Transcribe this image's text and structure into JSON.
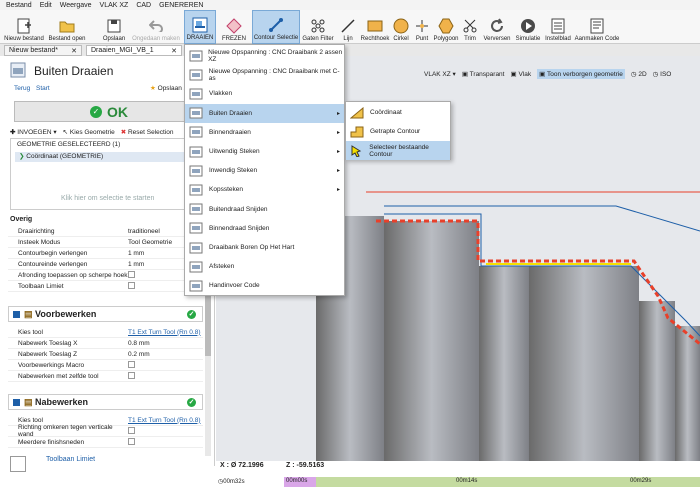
{
  "menubar": [
    "Bestand",
    "Edit",
    "Weergave",
    "VLAK XZ",
    "CAD",
    "GENEREREN"
  ],
  "ribbon": {
    "new_project": "Nieuw bestand",
    "open": "Bestand open",
    "save": "Opslaan",
    "undo": "Ongedaan maken",
    "turning": "DRAAIEN",
    "milling": "FREZEN",
    "contour_select": "Contour Selectie",
    "hole_filter": "Gaten Filter",
    "line": "Lijn",
    "rectangle": "Rechthoek",
    "circle": "Cirkel",
    "point": "Punt",
    "polygon": "Polygoon",
    "trim": "Trim",
    "refresh": "Verversen",
    "simulation": "Simulatie",
    "setup_sheet": "Instelblad",
    "make_code": "Aanmaken Code"
  },
  "tabs": [
    "Nieuw bestand*",
    "Draaien_MGI_VB_1"
  ],
  "panel": {
    "title": "Buiten Draaien",
    "back": "Terug",
    "start": "Start",
    "save_as": "Opslaan a",
    "ok": "OK",
    "insert": "INVOEGEN",
    "pick_geometry": "Kies Geometrie",
    "reset_selection": "Reset Selection",
    "selected_geometry": "GEOMETRIE GESELECTEERD",
    "selected_count": "(1)",
    "coordinate_item": "Coördinaat (GEOMETRIE)",
    "click_hint": "Klik hier om selectie te starten",
    "overig": "Overig",
    "props": [
      {
        "k": "Draairichting",
        "v": "traditioneel"
      },
      {
        "k": "Insteek Modus",
        "v": "Tool Geometrie"
      },
      {
        "k": "Contourbegin verlengen",
        "v": "1 mm"
      },
      {
        "k": "Contoureinde verlengen",
        "v": "1 mm"
      },
      {
        "k": "Afronding toepassen op scherpe hoek",
        "v": ""
      },
      {
        "k": "Toolbaan Limiet",
        "v": ""
      }
    ],
    "roughing": "Voorbewerken",
    "rough_props": [
      {
        "k": "Kies tool",
        "v": "T1 Ext Turn Tool  (Rn 0.8)"
      },
      {
        "k": "Nabewerk Toeslag X",
        "v": "0.8 mm"
      },
      {
        "k": "Nabewerk Toeslag Z",
        "v": "0.2 mm"
      },
      {
        "k": "Voorbewerkings Macro",
        "v": ""
      },
      {
        "k": "Nabewerken met zelfde tool",
        "v": ""
      }
    ],
    "finishing": "Nabewerken",
    "finish_props": [
      {
        "k": "Kies tool",
        "v": "T1 Ext Turn Tool  (Rn 0.8)"
      },
      {
        "k": "Richting omkeren tegen verticale wand",
        "v": ""
      },
      {
        "k": "Meerdere finishsneden",
        "v": ""
      }
    ],
    "toolpath_limit": "Toolbaan Limiet"
  },
  "viewtool": {
    "plane": "VLAK XZ",
    "transparent": "Transparant",
    "flat": "Vlak",
    "hidden_geometry": "Toon verborgen geometrie",
    "view2d": "2D",
    "iso": "ISO"
  },
  "draaien_menu": [
    "Nieuwe Opspanning : CNC Draaibank 2 assen XZ",
    "Nieuwe Opspanning : CNC Draaibank met C-as",
    "Vlakken",
    "Buiten Draaien",
    "Binnendraaien",
    "Uitwendig Steken",
    "Inwendig Steken",
    "Kopssteken",
    "Buitendraad Snijden",
    "Binnendraad Snijden",
    "Draaibank Boren Op Het Hart",
    "Afsteken",
    "Handinvoer Code"
  ],
  "submenu": [
    "Coördinaat",
    "Getrapte Contour",
    "Selecteer bestaande Contour"
  ],
  "status": {
    "x": "X : Ø 72.1996",
    "z": "Z : -59.5163"
  },
  "timeline": {
    "t0": "00m32s",
    "t1": "00m00s",
    "t2": "00m14s",
    "t3": "00m29s"
  },
  "colors": {
    "accent": "#b8d4ee",
    "ok": "#27a844",
    "contour": "#e8402a",
    "highlight": "#f5e000"
  }
}
